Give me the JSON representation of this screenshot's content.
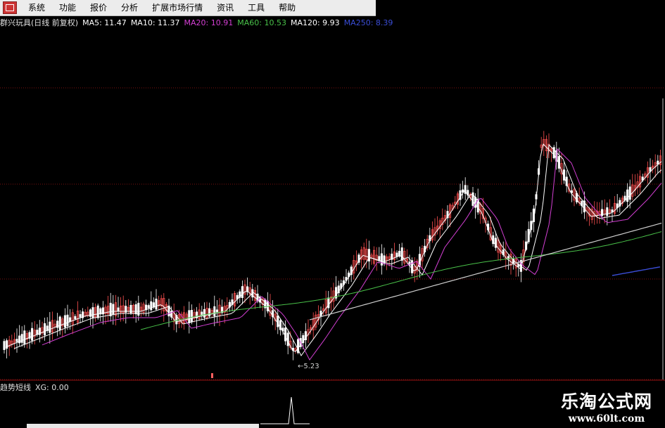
{
  "menu": {
    "items": [
      "系统",
      "功能",
      "报价",
      "分析",
      "扩展市场行情",
      "资讯",
      "工具",
      "帮助"
    ]
  },
  "chart_header": {
    "stock_title": "群兴玩具(日线 前复权)",
    "indicators": [
      {
        "label": "MA5: 11.47",
        "color": "#ffffff"
      },
      {
        "label": "MA10: 11.37",
        "color": "#ffffff"
      },
      {
        "label": "MA20: 10.91",
        "color": "#d33fd3"
      },
      {
        "label": "MA60: 10.53",
        "color": "#49c149"
      },
      {
        "label": "MA120: 9.93",
        "color": "#ffffff"
      },
      {
        "label": "MA250: 8.39",
        "color": "#3a4dd6"
      }
    ]
  },
  "low_marker": "←5.23",
  "sub_indicator": {
    "name": "趋势短线",
    "value": "XG: 0.00"
  },
  "watermark": {
    "title": "乐淘公式网",
    "url": "www.60lt.com"
  },
  "colors": {
    "background": "#000000",
    "grid": "#7a1010",
    "up_candle": "#ff5050",
    "down_candle": "#ffffff",
    "ma5": "#ffffff",
    "ma10": "#ffffff",
    "ma20": "#d33fd3",
    "ma60": "#49c149",
    "ma120": "#cfcfcf",
    "ma250": "#3a4dd6"
  },
  "chart_data": {
    "type": "candlestick",
    "title": "群兴玩具(日线 前复权)",
    "annotations": [
      "←5.23"
    ],
    "indicator_pane": {
      "name": "趋势短线",
      "series": "XG",
      "value": 0.0
    }
  }
}
